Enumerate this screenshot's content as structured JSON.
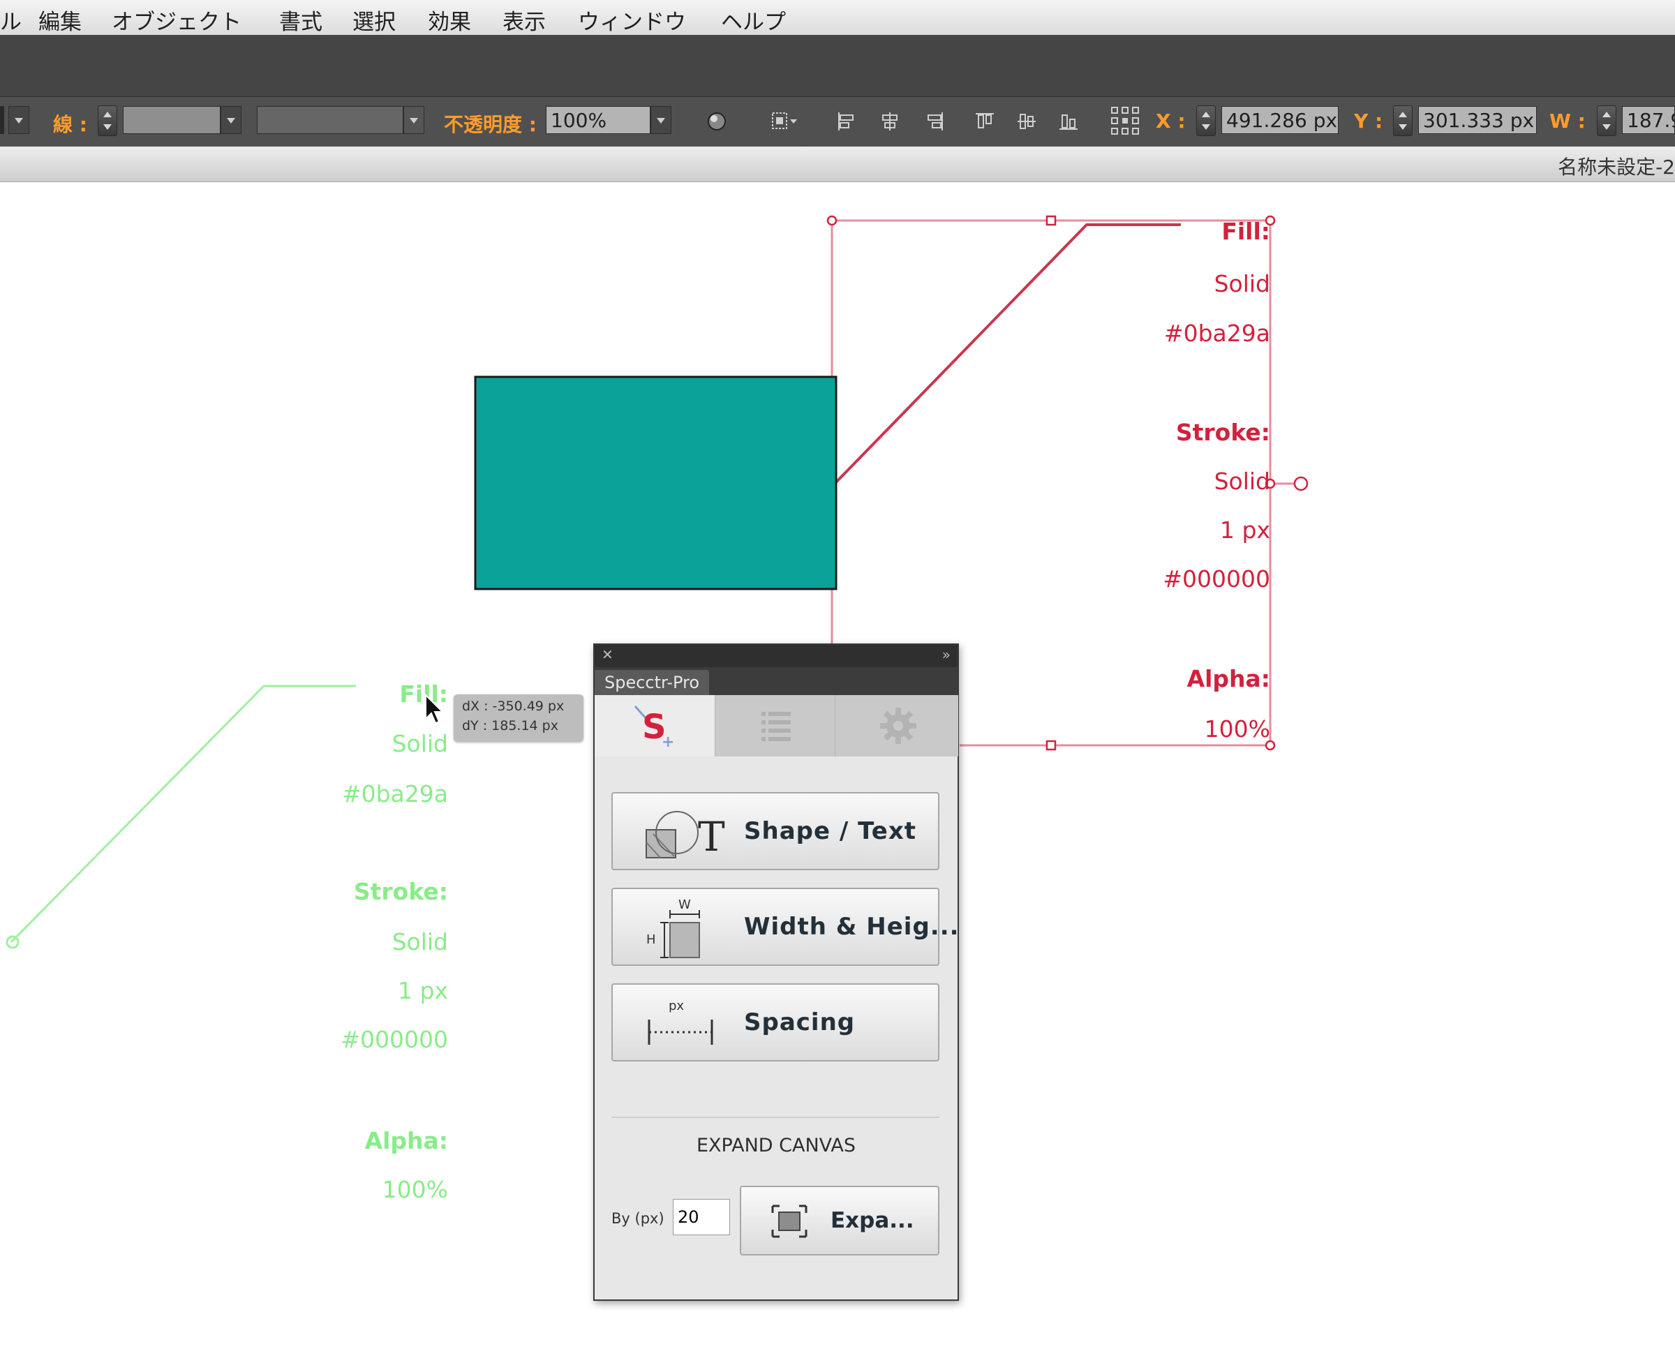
{
  "menubar": {
    "items": [
      "ル",
      "編集",
      "オブジェクト",
      "書式",
      "選択",
      "効果",
      "表示",
      "ウィンドウ",
      "ヘルプ"
    ]
  },
  "control_bar": {
    "stroke_label": "線 :",
    "opacity_label": "不透明度 :",
    "opacity_value": "100%",
    "x_label": "X :",
    "x_value": "491.286 px",
    "y_label": "Y :",
    "y_value": "301.333 px",
    "w_label": "W :",
    "w_value": "187.9"
  },
  "document": {
    "title": "名称未設定-2"
  },
  "canvas": {
    "rect_fill": "#0ba29a",
    "red_annotation": {
      "color": "#d3213d",
      "fill_label": "Fill:",
      "fill_type": "Solid",
      "fill_hex": "#0ba29a",
      "stroke_label": "Stroke:",
      "stroke_type": "Solid",
      "stroke_width": "1 px",
      "stroke_hex": "#000000",
      "alpha_label": "Alpha:",
      "alpha_value": "100%"
    },
    "green_annotation": {
      "color": "#7dea7d",
      "fill_label": "Fill:",
      "fill_type": "Solid",
      "fill_hex": "#0ba29a",
      "stroke_label": "Stroke:",
      "stroke_type": "Solid",
      "stroke_width": "1 px",
      "stroke_hex": "#000000",
      "alpha_label": "Alpha:",
      "alpha_value": "100%"
    },
    "drag_tooltip": {
      "dx": "dX : -350.49 px",
      "dy": "dY : 185.14 px"
    }
  },
  "panel": {
    "title": "Specctr-Pro",
    "tabs": [
      "specs-tab",
      "list-tab",
      "settings-tab"
    ],
    "buttons": {
      "shape_text": "Shape / Text",
      "width_height": "Width & Heig...",
      "spacing": "Spacing"
    },
    "icon_labels": {
      "w": "W",
      "h": "H",
      "px": "px",
      "t": "T"
    },
    "expand_heading": "EXPAND CANVAS",
    "by_label": "By (px)",
    "by_value": "20",
    "expand_button": "Expa..."
  }
}
